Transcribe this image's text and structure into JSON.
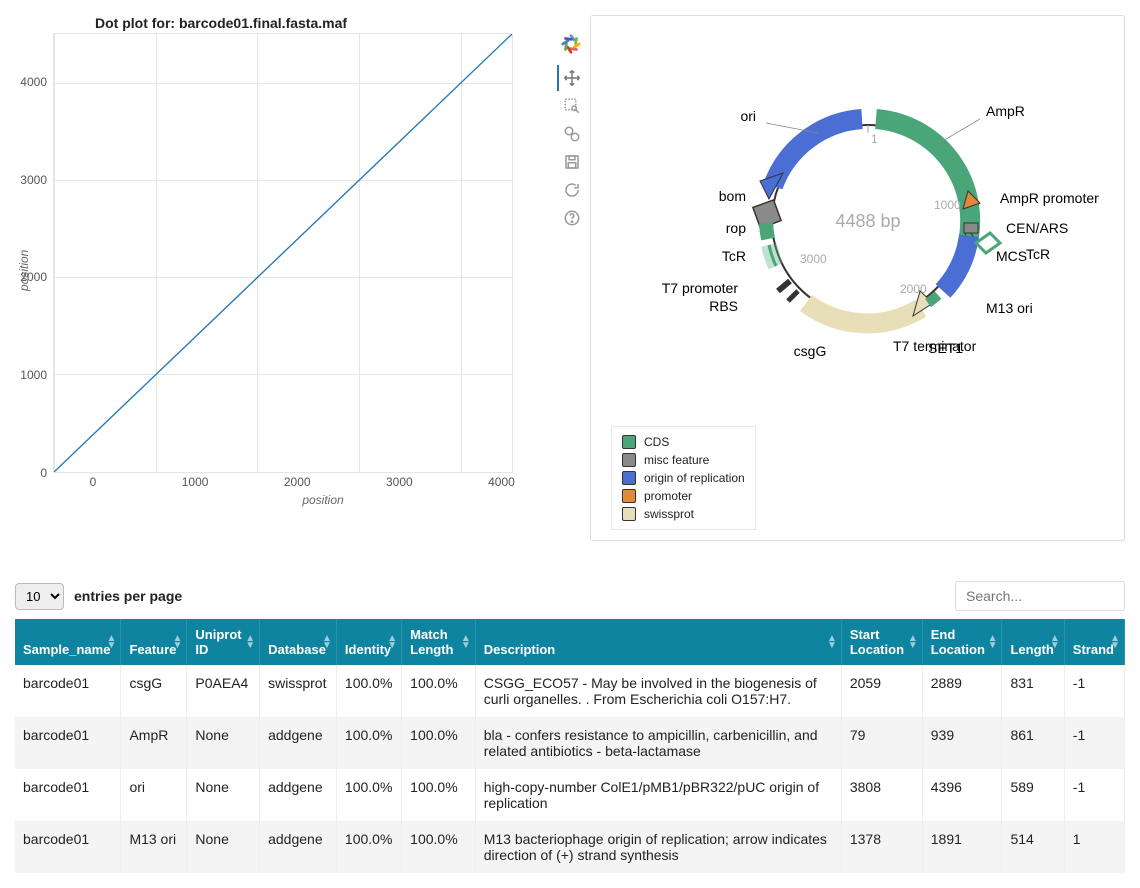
{
  "plot": {
    "title": "Dot plot for: barcode01.final.fasta.maf",
    "xlabel": "position",
    "ylabel": "position",
    "yticks": [
      "0",
      "1000",
      "2000",
      "3000",
      "4000"
    ],
    "xticks": [
      "0",
      "1000",
      "2000",
      "3000",
      "4000"
    ]
  },
  "chart_data": {
    "type": "line",
    "title": "Dot plot for: barcode01.final.fasta.maf",
    "xlabel": "position",
    "ylabel": "position",
    "x": [
      0,
      4500
    ],
    "y": [
      0,
      4500
    ],
    "xlim": [
      0,
      4500
    ],
    "ylim": [
      0,
      4500
    ]
  },
  "toolbar": {
    "tools": [
      {
        "name": "pan",
        "active": true
      },
      {
        "name": "box-zoom",
        "active": false
      },
      {
        "name": "wheel-zoom",
        "active": false
      },
      {
        "name": "save",
        "active": false
      },
      {
        "name": "reset",
        "active": false
      },
      {
        "name": "help",
        "active": false
      }
    ]
  },
  "plasmid": {
    "size_label": "4488 bp",
    "position_marks": {
      "p1": "1",
      "p1000": "1000",
      "p2000": "2000",
      "p3000": "3000"
    },
    "features": {
      "ori": "ori",
      "ampr": "AmpR",
      "ampr_prom": "AmpR promoter",
      "cen_ars": "CEN/ARS",
      "tcr_right": "TcR",
      "mcs": "MCS",
      "m13": "M13 ori",
      "t7_term": "T7 terminator",
      "set1": "SET1",
      "csgg": "csgG",
      "rbs": "RBS",
      "t7_prom": "T7 promoter",
      "tcr_left": "TcR",
      "rop": "rop",
      "bom": "bom"
    }
  },
  "legend": {
    "cds": {
      "label": "CDS",
      "color": "#4aa578"
    },
    "misc": {
      "label": "misc feature",
      "color": "#8a8a8a"
    },
    "ori": {
      "label": "origin of replication",
      "color": "#4a6ed4"
    },
    "prom": {
      "label": "promoter",
      "color": "#e08a3a"
    },
    "swiss": {
      "label": "swissprot",
      "color": "#e8dfb9"
    }
  },
  "tableControls": {
    "entriesValue": "10",
    "entriesLabel": "entries per page",
    "searchPlaceholder": "Search..."
  },
  "table": {
    "headers": {
      "sample": "Sample_name",
      "feature": "Feature",
      "uniprot": "Uniprot ID",
      "db": "Database",
      "identity": "Identity",
      "match": "Match Length",
      "desc": "Description",
      "start": "Start Location",
      "end": "End Location",
      "length": "Length",
      "strand": "Strand"
    },
    "rows": [
      {
        "sample": "barcode01",
        "feature": "csgG",
        "uniprot": "P0AEA4",
        "db": "swissprot",
        "identity": "100.0%",
        "match": "100.0%",
        "desc": "CSGG_ECO57 - May be involved in the biogenesis of curli organelles. . From Escherichia coli O157:H7.",
        "start": "2059",
        "end": "2889",
        "length": "831",
        "strand": "-1"
      },
      {
        "sample": "barcode01",
        "feature": "AmpR",
        "uniprot": "None",
        "db": "addgene",
        "identity": "100.0%",
        "match": "100.0%",
        "desc": "bla - confers resistance to ampicillin, carbenicillin, and related antibiotics - beta-lactamase",
        "start": "79",
        "end": "939",
        "length": "861",
        "strand": "-1"
      },
      {
        "sample": "barcode01",
        "feature": "ori",
        "uniprot": "None",
        "db": "addgene",
        "identity": "100.0%",
        "match": "100.0%",
        "desc": "high-copy-number ColE1/pMB1/pBR322/pUC origin of replication",
        "start": "3808",
        "end": "4396",
        "length": "589",
        "strand": "-1"
      },
      {
        "sample": "barcode01",
        "feature": "M13 ori",
        "uniprot": "None",
        "db": "addgene",
        "identity": "100.0%",
        "match": "100.0%",
        "desc": "M13 bacteriophage origin of replication; arrow indicates direction of (+) strand synthesis",
        "start": "1378",
        "end": "1891",
        "length": "514",
        "strand": "1"
      }
    ]
  }
}
